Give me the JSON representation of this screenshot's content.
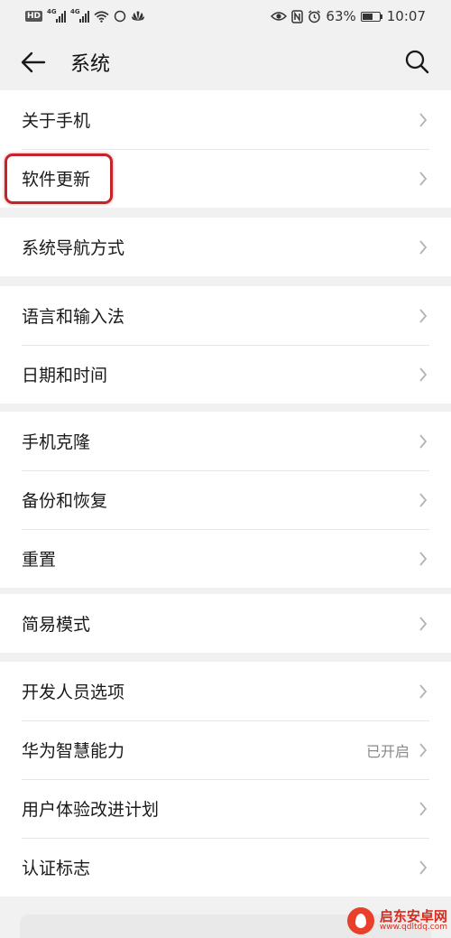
{
  "status_bar": {
    "hd": "HD",
    "net1": "4G",
    "net2": "4G",
    "battery_percent": "63%",
    "battery_level": 0.63,
    "time": "10:07",
    "icons": [
      "wifi-icon",
      "sync-icon",
      "huawei-icon",
      "eye-comfort-icon",
      "nfc-icon",
      "alarm-icon"
    ]
  },
  "header": {
    "title": "系统",
    "back_icon": "arrow-left-icon",
    "search_icon": "search-icon"
  },
  "groups": [
    {
      "items": [
        {
          "label": "关于手机"
        },
        {
          "label": "软件更新",
          "highlighted": true
        }
      ]
    },
    {
      "items": [
        {
          "label": "系统导航方式"
        }
      ]
    },
    {
      "items": [
        {
          "label": "语言和输入法"
        },
        {
          "label": "日期和时间"
        }
      ]
    },
    {
      "items": [
        {
          "label": "手机克隆"
        },
        {
          "label": "备份和恢复"
        },
        {
          "label": "重置"
        }
      ]
    },
    {
      "items": [
        {
          "label": "简易模式"
        }
      ]
    },
    {
      "items": [
        {
          "label": "开发人员选项"
        },
        {
          "label": "华为智慧能力",
          "value": "已开启"
        },
        {
          "label": "用户体验改进计划"
        },
        {
          "label": "认证标志"
        }
      ]
    }
  ],
  "colors": {
    "highlight": "#c4232a",
    "background": "#f1f1f1"
  },
  "watermark": {
    "text": "启东安卓网",
    "url": "www.qdltdq.com"
  }
}
